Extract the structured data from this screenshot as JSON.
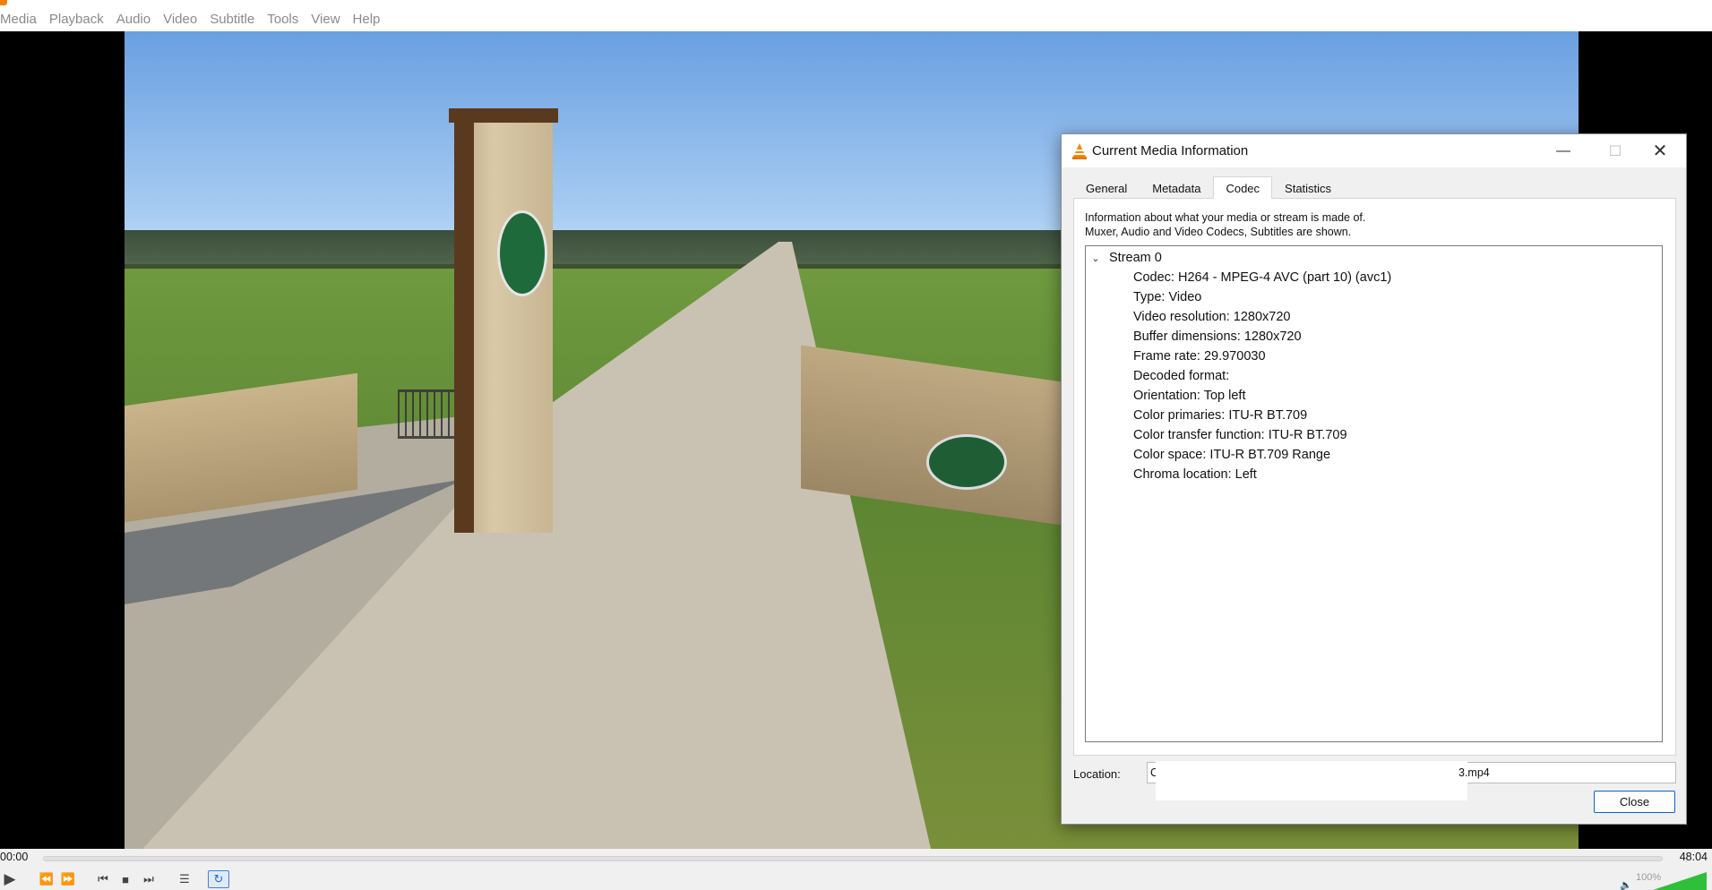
{
  "menubar": {
    "items": [
      "Media",
      "Playback",
      "Audio",
      "Video",
      "Subtitle",
      "Tools",
      "View",
      "Help"
    ]
  },
  "dialog": {
    "title": "Current Media Information",
    "tabs": [
      "General",
      "Metadata",
      "Codec",
      "Statistics"
    ],
    "active_tab": "Codec",
    "info_line1": "Information about what your media or stream is made of.",
    "info_line2": "Muxer, Audio and Video Codecs, Subtitles are shown.",
    "stream": {
      "label": "Stream 0",
      "rows": [
        "Codec: H264 - MPEG-4 AVC (part 10) (avc1)",
        "Type: Video",
        "Video resolution: 1280x720",
        "Buffer dimensions: 1280x720",
        "Frame rate: 29.970030",
        "Decoded format:",
        "Orientation: Top left",
        "Color primaries: ITU-R BT.709",
        "Color transfer function: ITU-R BT.709",
        "Color space: ITU-R BT.709 Range",
        "Chroma location: Left"
      ]
    },
    "location_label": "Location:",
    "location_prefix": "C",
    "location_suffix": "3.mp4",
    "close_label": "Close"
  },
  "controls": {
    "time_current": "00:00",
    "time_total": "48:04",
    "volume": "100%",
    "icons": [
      "play-icon",
      "prev-icon",
      "next-icon",
      "skip-back-icon",
      "stop-icon",
      "skip-forward-icon",
      "equalizer-icon",
      "loop-icon"
    ]
  }
}
